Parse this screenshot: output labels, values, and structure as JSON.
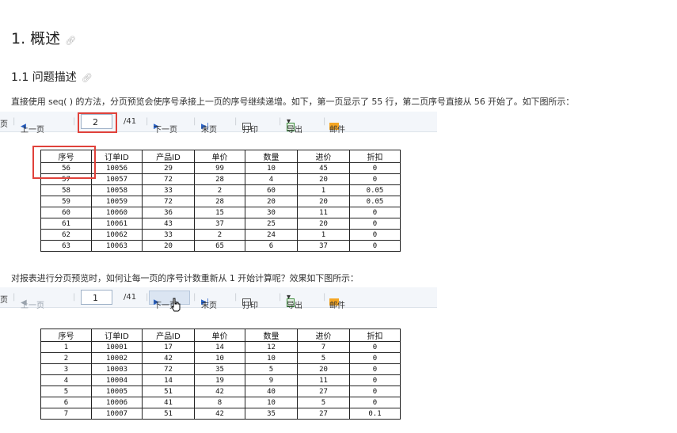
{
  "doc": {
    "heading1": "1. 概述",
    "heading2": "1.1 问题描述",
    "para1": "直接使用 seq( ) 的方法，分页预览会使序号承接上一页的序号继续递增。如下，第一页显示了 55 行，第二页序号直接从 56 开始了。如下图所示：",
    "para2": "对报表进行分页预览时，如何让每一页的序号计数重新从 1 开始计算呢？效果如下图所示："
  },
  "toolbar": {
    "page_frag": "页",
    "prev": "上一页",
    "total": "/41",
    "next": "下一页",
    "last": "末页",
    "print": "打印",
    "export": "导出",
    "mail": "邮件"
  },
  "shot1": {
    "page": "2"
  },
  "shot2": {
    "page": "1"
  },
  "columns": [
    "序号",
    "订单ID",
    "产品ID",
    "单价",
    "数量",
    "进价",
    "折扣"
  ],
  "table1": [
    [
      "56",
      "10056",
      "29",
      "99",
      "10",
      "45",
      "0"
    ],
    [
      "57",
      "10057",
      "72",
      "28",
      "4",
      "20",
      "0"
    ],
    [
      "58",
      "10058",
      "33",
      "2",
      "60",
      "1",
      "0.05"
    ],
    [
      "59",
      "10059",
      "72",
      "28",
      "20",
      "20",
      "0.05"
    ],
    [
      "60",
      "10060",
      "36",
      "15",
      "30",
      "11",
      "0"
    ],
    [
      "61",
      "10061",
      "43",
      "37",
      "25",
      "20",
      "0"
    ],
    [
      "62",
      "10062",
      "33",
      "2",
      "24",
      "1",
      "0"
    ],
    [
      "63",
      "10063",
      "20",
      "65",
      "6",
      "37",
      "0"
    ]
  ],
  "table2": [
    [
      "1",
      "10001",
      "17",
      "14",
      "12",
      "7",
      "0"
    ],
    [
      "2",
      "10002",
      "42",
      "10",
      "10",
      "5",
      "0"
    ],
    [
      "3",
      "10003",
      "72",
      "35",
      "5",
      "20",
      "0"
    ],
    [
      "4",
      "10004",
      "14",
      "19",
      "9",
      "11",
      "0"
    ],
    [
      "5",
      "10005",
      "51",
      "42",
      "40",
      "27",
      "0"
    ],
    [
      "6",
      "10006",
      "41",
      "8",
      "10",
      "5",
      "0"
    ],
    [
      "7",
      "10007",
      "51",
      "42",
      "35",
      "27",
      "0.1"
    ]
  ]
}
